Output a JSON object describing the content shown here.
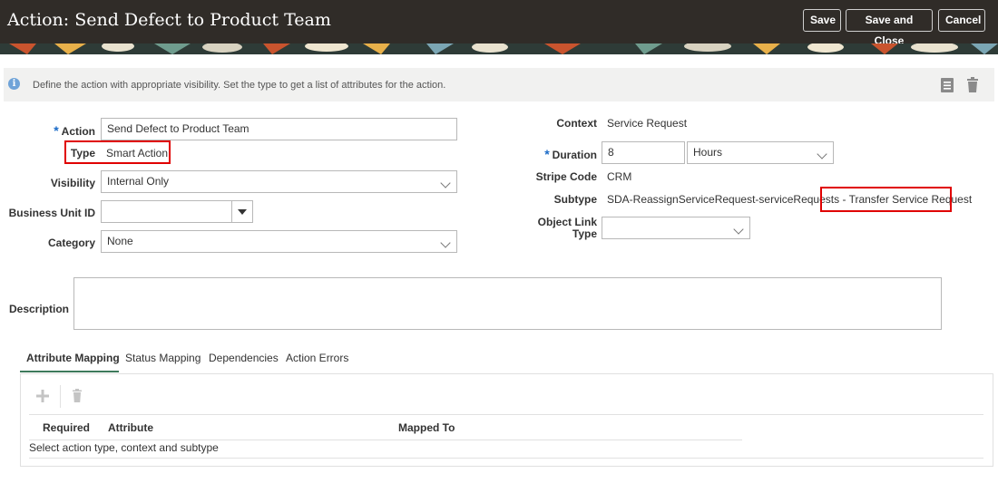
{
  "header": {
    "title": "Action: Send Defect to Product Team",
    "buttons": {
      "save": "Save",
      "save_and_close": "Save and Close",
      "cancel": "Cancel"
    }
  },
  "info": {
    "icon": "info-icon",
    "text": "Define the action with appropriate visibility. Set the type to get a list of attributes for the action."
  },
  "form_left": {
    "action": {
      "label": "Action",
      "required_mark": "*",
      "value": "Send Defect to Product Team"
    },
    "type": {
      "label": "Type",
      "value": "Smart Action"
    },
    "visibility": {
      "label": "Visibility",
      "value": "Internal Only"
    },
    "business_unit": {
      "label": "Business Unit ID",
      "value": ""
    },
    "category": {
      "label": "Category",
      "value": "None"
    }
  },
  "form_right": {
    "context": {
      "label": "Context",
      "value": "Service Request"
    },
    "duration": {
      "label": "Duration",
      "required_mark": "*",
      "value": "8",
      "unit": "Hours"
    },
    "stripe_code": {
      "label": "Stripe Code",
      "value": "CRM"
    },
    "subtype": {
      "label": "Subtype",
      "value": "SDA-ReassignServiceRequest-serviceRequests",
      "separator": "-",
      "value2": "Transfer Service Request"
    },
    "object_link_type": {
      "label_line1": "Object Link",
      "label_line2": "Type",
      "value": ""
    }
  },
  "description": {
    "label": "Description",
    "value": ""
  },
  "tabs": [
    "Attribute Mapping",
    "Status Mapping",
    "Dependencies",
    "Action Errors"
  ],
  "table": {
    "columns": [
      "Required",
      "Attribute",
      "Mapped To"
    ],
    "empty_text": "Select action type, context and subtype"
  },
  "colors": {
    "header_bg": "#302c28",
    "highlight": "#e00000",
    "required": "#1a6ac7",
    "tab_underline": "#3e7a5c"
  }
}
